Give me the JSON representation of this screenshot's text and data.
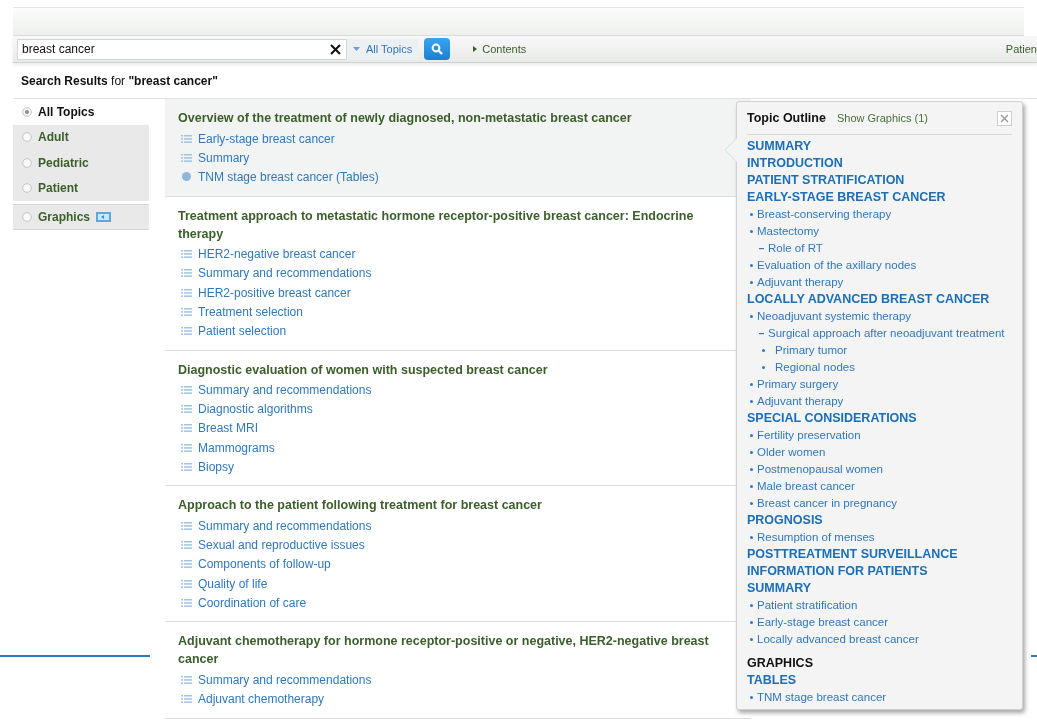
{
  "search": {
    "value": "breast cancer",
    "scope": "All Topics",
    "contents_link": "Contents",
    "right_link": "Patien"
  },
  "results_heading": {
    "label": "Search Results",
    "for": "for",
    "query": "\"breast cancer\""
  },
  "filters": [
    {
      "label": "All Topics",
      "selected": true,
      "icon": false
    },
    {
      "label": "Adult",
      "selected": false,
      "icon": false
    },
    {
      "label": "Pediatric",
      "selected": false,
      "icon": false
    },
    {
      "label": "Patient",
      "selected": false,
      "icon": false
    },
    {
      "label": "Graphics",
      "selected": false,
      "icon": true
    }
  ],
  "results": [
    {
      "title": "Overview of the treatment of newly diagnosed, non-metastatic breast cancer",
      "selected": true,
      "links": [
        {
          "text": "Early-stage breast cancer",
          "kind": "section"
        },
        {
          "text": "Summary",
          "kind": "section"
        },
        {
          "text": "TNM stage breast cancer (Tables)",
          "kind": "table"
        }
      ]
    },
    {
      "title": "Treatment approach to metastatic hormone receptor-positive breast cancer: Endocrine therapy",
      "selected": false,
      "links": [
        {
          "text": "HER2-negative breast cancer",
          "kind": "section"
        },
        {
          "text": "Summary and recommendations",
          "kind": "section"
        },
        {
          "text": "HER2-positive breast cancer",
          "kind": "section"
        },
        {
          "text": "Treatment selection",
          "kind": "section"
        },
        {
          "text": "Patient selection",
          "kind": "section"
        }
      ]
    },
    {
      "title": "Diagnostic evaluation of women with suspected breast cancer",
      "selected": false,
      "links": [
        {
          "text": "Summary and recommendations",
          "kind": "section"
        },
        {
          "text": "Diagnostic algorithms",
          "kind": "section"
        },
        {
          "text": "Breast MRI",
          "kind": "section"
        },
        {
          "text": "Mammograms",
          "kind": "section"
        },
        {
          "text": "Biopsy",
          "kind": "section"
        }
      ]
    },
    {
      "title": "Approach to the patient following treatment for breast cancer",
      "selected": false,
      "links": [
        {
          "text": "Summary and recommendations",
          "kind": "section"
        },
        {
          "text": "Sexual and reproductive issues",
          "kind": "section"
        },
        {
          "text": "Components of follow-up",
          "kind": "section"
        },
        {
          "text": "Quality of life",
          "kind": "section"
        },
        {
          "text": "Coordination of care",
          "kind": "section"
        }
      ]
    },
    {
      "title": "Adjuvant chemotherapy for hormone receptor-positive or negative, HER2-negative breast cancer",
      "selected": false,
      "links": [
        {
          "text": "Summary and recommendations",
          "kind": "section"
        },
        {
          "text": "Adjuvant chemotherapy",
          "kind": "section"
        }
      ]
    }
  ],
  "outline": {
    "title": "Topic Outline",
    "show_graphics": "Show Graphics (1)",
    "sections": [
      {
        "text": "SUMMARY",
        "kind": "link"
      },
      {
        "text": "INTRODUCTION",
        "kind": "link"
      },
      {
        "text": "PATIENT STRATIFICATION",
        "kind": "link"
      },
      {
        "text": "EARLY-STAGE BREAST CANCER",
        "kind": "link",
        "children": [
          {
            "text": "Breast-conserving therapy"
          },
          {
            "text": "Mastectomy",
            "children": [
              {
                "text": "Role of RT"
              }
            ]
          },
          {
            "text": "Evaluation of the axillary nodes"
          },
          {
            "text": "Adjuvant therapy"
          }
        ]
      },
      {
        "text": "LOCALLY ADVANCED BREAST CANCER",
        "kind": "link",
        "children": [
          {
            "text": "Neoadjuvant systemic therapy",
            "children": [
              {
                "text": "Surgical approach after neoadjuvant treatment",
                "children": [
                  {
                    "text": "Primary tumor"
                  },
                  {
                    "text": "Regional nodes"
                  }
                ]
              }
            ]
          },
          {
            "text": "Primary surgery"
          },
          {
            "text": "Adjuvant therapy"
          }
        ]
      },
      {
        "text": "SPECIAL CONSIDERATIONS",
        "kind": "link",
        "children": [
          {
            "text": "Fertility preservation"
          },
          {
            "text": "Older women"
          },
          {
            "text": "Postmenopausal women"
          },
          {
            "text": "Male breast cancer"
          },
          {
            "text": "Breast cancer in pregnancy"
          }
        ]
      },
      {
        "text": "PROGNOSIS",
        "kind": "link",
        "children": [
          {
            "text": "Resumption of menses"
          }
        ]
      },
      {
        "text": "POSTTREATMENT SURVEILLANCE",
        "kind": "link"
      },
      {
        "text": "INFORMATION FOR PATIENTS",
        "kind": "link"
      },
      {
        "text": "SUMMARY",
        "kind": "link",
        "children": [
          {
            "text": "Patient stratification"
          },
          {
            "text": "Early-stage breast cancer"
          },
          {
            "text": "Locally advanced breast cancer"
          }
        ]
      },
      {
        "text": "GRAPHICS",
        "kind": "label"
      },
      {
        "text": "TABLES",
        "kind": "link",
        "children": [
          {
            "text": "TNM stage breast cancer"
          }
        ]
      }
    ]
  }
}
